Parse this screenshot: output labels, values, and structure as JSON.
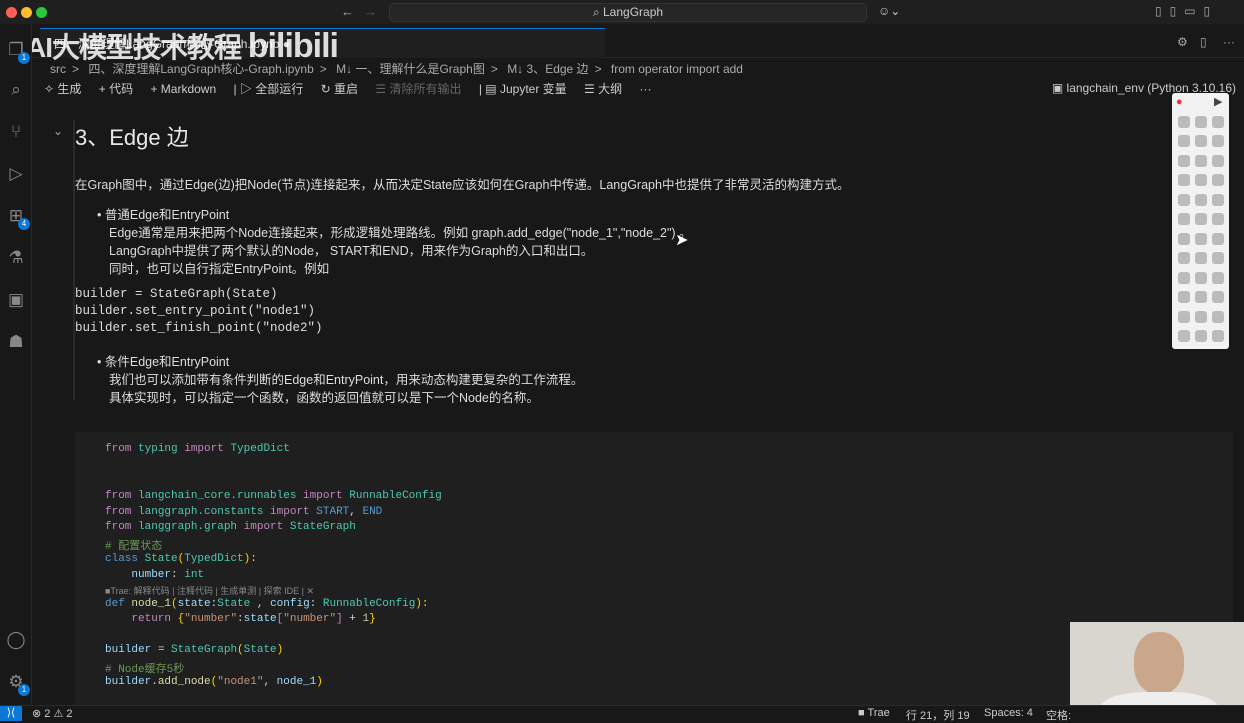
{
  "window": {
    "search": "LangGraph",
    "watermark": "AI大模型技术教程 bilibili"
  },
  "tab": {
    "label": "四、深度理解LangGraph核心-Graph.ipynb"
  },
  "breadcrumb": [
    "src",
    ">",
    "四、深度理解LangGraph核心-Graph.ipynb",
    ">",
    "M↓ 一、理解什么是Graph图",
    ">",
    "M↓ 3、Edge 边",
    ">",
    "from operator import add"
  ],
  "toolbar": {
    "generate": "生成",
    "code": "+ 代码",
    "markdown": "+ Markdown",
    "run_all": "全部运行",
    "restart": "重启",
    "clear": "清除所有输出",
    "variables": "Jupyter 变量",
    "outline": "大纲",
    "more": "···"
  },
  "kernel": "langchain_env (Python 3.10.16)",
  "activity": {
    "explorer_badge": "1",
    "extensions_badge": "4",
    "settings_badge": "1"
  },
  "markdown": {
    "heading": "3、Edge 边",
    "intro": "在Graph图中，通过Edge(边)把Node(节点)连接起来，从而决定State应该如何在Graph中传递。LangGraph中也提供了非常灵活的构建方式。",
    "bullet1": "普通Edge和EntryPoint",
    "b1_lines": [
      "Edge通常是用来把两个Node连接起来，形成逻辑处理路线。例如 graph.add_edge(\"node_1\",\"node_2\") 。",
      "LangGraph中提供了两个默认的Node， START和END，用来作为Graph的入口和出口。",
      "同时，也可以自行指定EntryPoint。例如"
    ],
    "code": [
      "builder = StateGraph(State)",
      "builder.set_entry_point(\"node1\")",
      "builder.set_finish_point(\"node2\")"
    ],
    "bullet2": "条件Edge和EntryPoint",
    "b2_lines": [
      "我们也可以添加带有条件判断的Edge和EntryPoint，用来动态构建更复杂的工作流程。",
      "具体实现时，可以指定一个函数，函数的返回值就可以是下一个Node的名称。"
    ]
  },
  "code_cell": [
    [
      [
        "from ",
        "kw"
      ],
      [
        "typing ",
        "ty"
      ],
      [
        "import ",
        "kw"
      ],
      [
        "TypedDict",
        "ty"
      ]
    ],
    [],
    [
      [
        "from ",
        "kw"
      ],
      [
        "langchain_core.runnables ",
        "ty"
      ],
      [
        "import ",
        "kw"
      ],
      [
        "RunnableConfig",
        "ty"
      ]
    ],
    [
      [
        "from ",
        "kw"
      ],
      [
        "langgraph.constants ",
        "ty"
      ],
      [
        "import ",
        "kw"
      ],
      [
        "START",
        "kb"
      ],
      [
        ", ",
        "pl"
      ],
      [
        "END",
        "kb"
      ]
    ],
    [
      [
        "from ",
        "kw"
      ],
      [
        "langgraph.graph ",
        "ty"
      ],
      [
        "import ",
        "kw"
      ],
      [
        "StateGraph",
        "ty"
      ]
    ],
    [
      [
        "# 配置状态",
        "cm"
      ]
    ],
    [
      [
        "class ",
        "kb"
      ],
      [
        "State",
        "ty"
      ],
      [
        "(",
        "yl"
      ],
      [
        "TypedDict",
        "ty"
      ],
      [
        "):",
        "yl"
      ]
    ],
    [
      [
        "    number",
        "va"
      ],
      [
        ": ",
        "pl"
      ],
      [
        "int",
        "ty"
      ]
    ],
    [],
    [
      [
        "■Trae: 解释代码 | 注释代码 | 生成单测 | 探索 IDE | ✕",
        "hint"
      ]
    ],
    [
      [
        "def ",
        "kb"
      ],
      [
        "node_1",
        "fn"
      ],
      [
        "(",
        "yl"
      ],
      [
        "state",
        "va"
      ],
      [
        ":",
        "pl"
      ],
      [
        "State ",
        "ty"
      ],
      [
        ", ",
        "pl"
      ],
      [
        "config",
        "va"
      ],
      [
        ": ",
        "pl"
      ],
      [
        "RunnableConfig",
        "ty"
      ],
      [
        "):",
        "yl"
      ]
    ],
    [
      [
        "    return ",
        "kw"
      ],
      [
        "{",
        "yl"
      ],
      [
        "\"number\"",
        "st"
      ],
      [
        ":",
        "pl"
      ],
      [
        "state",
        "va"
      ],
      [
        "[",
        "kw"
      ],
      [
        "\"number\"",
        "st"
      ],
      [
        "]",
        "kw"
      ],
      [
        " + ",
        "pl"
      ],
      [
        "1",
        "nm"
      ],
      [
        "}",
        "yl"
      ]
    ],
    [],
    [
      [
        "builder",
        "va"
      ],
      [
        " = ",
        "pl"
      ],
      [
        "StateGraph",
        "ty"
      ],
      [
        "(",
        "yl"
      ],
      [
        "State",
        "ty"
      ],
      [
        ")",
        "yl"
      ]
    ],
    [
      [
        "# Node缓存5秒",
        "cm"
      ]
    ],
    [
      [
        "builder",
        "va"
      ],
      [
        ".",
        "pl"
      ],
      [
        "add_node",
        "fn"
      ],
      [
        "(",
        "yl"
      ],
      [
        "\"node1\"",
        "st"
      ],
      [
        ", ",
        "pl"
      ],
      [
        "node_1",
        "va"
      ],
      [
        ")",
        "yl"
      ]
    ]
  ],
  "status": {
    "errors": "⊗ 2",
    "warnings": "⚠ 2",
    "trae": "Trae",
    "position": "行 21，列 19",
    "spaces": "Spaces: 4",
    "encoding": "空格:"
  }
}
